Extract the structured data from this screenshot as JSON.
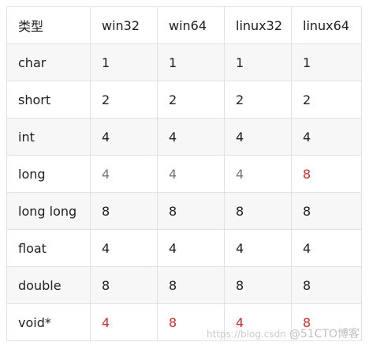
{
  "table": {
    "headers": [
      "类型",
      "win32",
      "win64",
      "linux32",
      "linux64"
    ],
    "rows": [
      {
        "type": "char",
        "win32": "1",
        "win64": "1",
        "linux32": "1",
        "linux64": "1"
      },
      {
        "type": "short",
        "win32": "2",
        "win64": "2",
        "linux32": "2",
        "linux64": "2"
      },
      {
        "type": "int",
        "win32": "4",
        "win64": "4",
        "linux32": "4",
        "linux64": "4"
      },
      {
        "type": "long",
        "win32": "4",
        "win64": "4",
        "linux32": "4",
        "linux64": "8"
      },
      {
        "type": "long long",
        "win32": "8",
        "win64": "8",
        "linux32": "8",
        "linux64": "8"
      },
      {
        "type": "float",
        "win32": "4",
        "win64": "4",
        "linux32": "4",
        "linux64": "4"
      },
      {
        "type": "double",
        "win32": "8",
        "win64": "8",
        "linux32": "8",
        "linux64": "8"
      },
      {
        "type": "void*",
        "win32": "4",
        "win64": "8",
        "linux32": "4",
        "linux64": "8"
      }
    ]
  },
  "colors": {
    "highlight": "#d92b2b",
    "muted": "#777777",
    "border": "#dfe2e5",
    "stripe": "#f7f7f7"
  },
  "watermark": {
    "url": "https://blog.csdn",
    "brand": "@51CTO博客"
  }
}
